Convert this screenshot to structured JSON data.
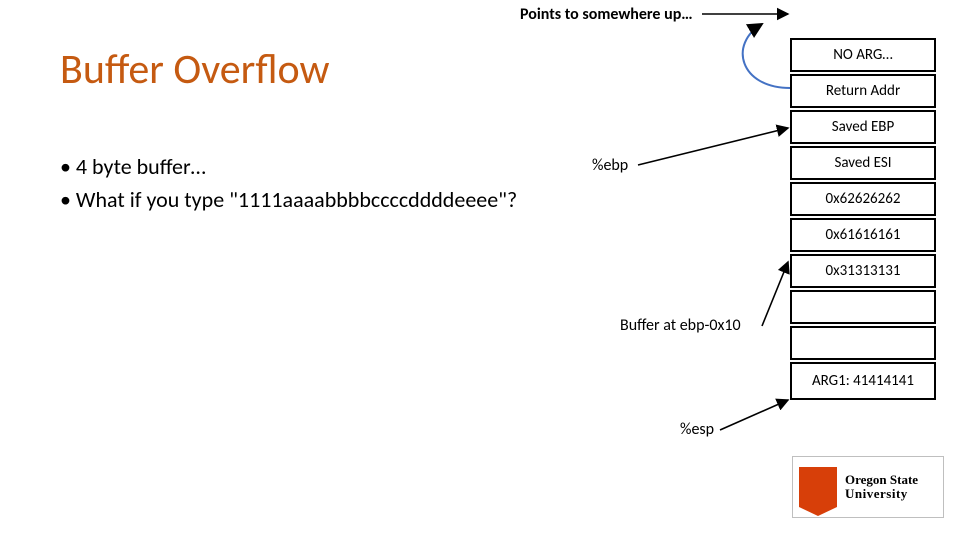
{
  "top_note": "Points to somewhere up…",
  "title": "Buffer Overflow",
  "bullets": {
    "b1": "• 4 byte buffer…",
    "b2": "• What if you type \"1111aaaabbbbccccddddeeee\"?"
  },
  "stack": {
    "c0": "NO ARG…",
    "c1": "Return Addr",
    "c2": "Saved EBP",
    "c3": "Saved ESI",
    "c4": "0x62626262",
    "c5": "0x61616161",
    "c6": "0x31313131",
    "c7": "",
    "c8": "",
    "c9": "ARG1: 41414141"
  },
  "labels": {
    "ebp": "%ebp",
    "buf": "Buffer at ebp-0x10",
    "esp": "%esp"
  },
  "logo": {
    "l1": "Oregon State",
    "l2": "University"
  }
}
